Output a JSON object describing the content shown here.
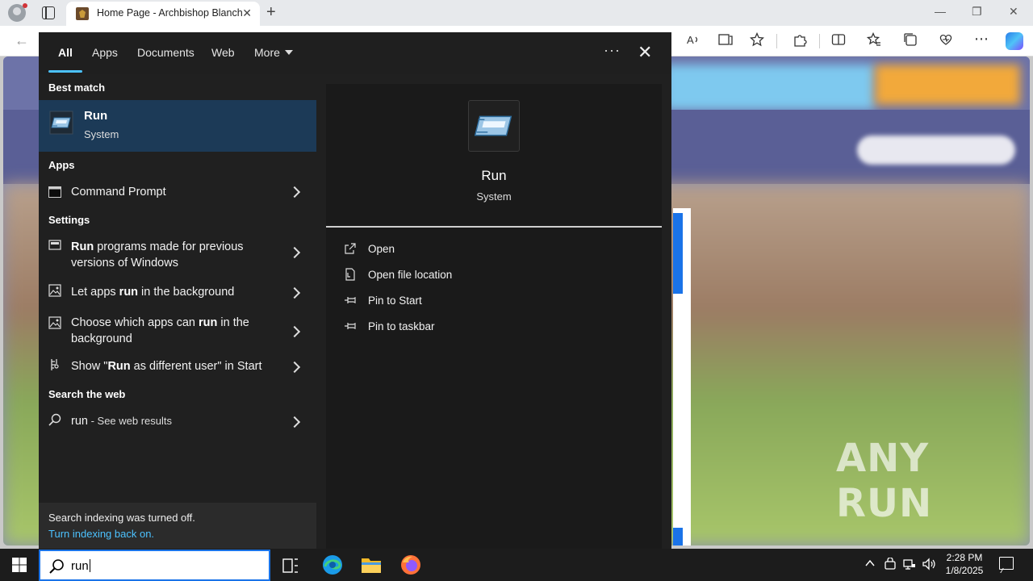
{
  "browser": {
    "tab_title": "Home Page - Archbishop Blanch",
    "tab_close": "✕",
    "new_tab": "+",
    "minimize": "—",
    "restore": "❐",
    "close": "✕",
    "back": "←"
  },
  "search_tabs": [
    {
      "label": "All",
      "active": true
    },
    {
      "label": "Apps"
    },
    {
      "label": "Documents"
    },
    {
      "label": "Web"
    },
    {
      "label": "More"
    }
  ],
  "panel": {
    "more_options": "···",
    "close": "✕"
  },
  "best_match": {
    "heading": "Best match",
    "name": "Run",
    "sub": "System"
  },
  "apps": {
    "heading": "Apps",
    "items": [
      {
        "label": "Command Prompt"
      }
    ]
  },
  "settings": {
    "heading": "Settings",
    "items": [
      {
        "bold": "Run",
        "rest": " programs made for previous versions of Windows"
      },
      {
        "pre": "Let apps ",
        "bold": "run",
        "rest": " in the background"
      },
      {
        "pre": "Choose which apps can ",
        "bold": "run",
        "rest": " in the background"
      },
      {
        "pre": "Show \"",
        "bold": "Run",
        "rest": " as different user\" in Start"
      }
    ]
  },
  "web": {
    "heading": "Search the web",
    "query": "run",
    "suffix": " - See web results"
  },
  "indexing": {
    "message": "Search indexing was turned off.",
    "link": "Turn indexing back on."
  },
  "preview": {
    "name": "Run",
    "sub": "System",
    "actions": [
      {
        "label": "Open",
        "icon": "open-icon"
      },
      {
        "label": "Open file location",
        "icon": "file-location-icon"
      },
      {
        "label": "Pin to Start",
        "icon": "pin-icon"
      },
      {
        "label": "Pin to taskbar",
        "icon": "pin-icon"
      }
    ]
  },
  "taskbar": {
    "search_text": "run",
    "time": "2:28 PM",
    "date": "1/8/2025"
  },
  "watermark": "ANY RUN"
}
